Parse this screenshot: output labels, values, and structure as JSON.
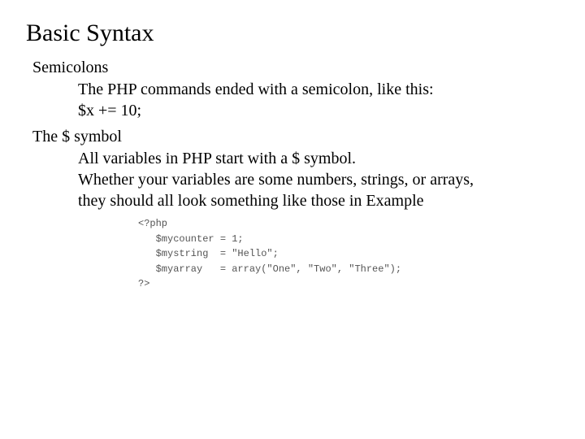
{
  "title": "Basic Syntax",
  "semicolons": {
    "heading": "Semicolons",
    "line1": "The PHP commands ended with a semicolon, like this:",
    "line2": "$x += 10;"
  },
  "dollar": {
    "heading": "The $ symbol",
    "line1": "All variables in PHP start with a $ symbol.",
    "line2": "Whether your variables are some numbers, strings, or arrays,",
    "line3": "they should all look something like those in Example"
  },
  "code": {
    "l1": "<?php",
    "l2": "   $mycounter = 1;",
    "l3": "   $mystring  = \"Hello\";",
    "l4": "   $myarray   = array(\"One\", \"Two\", \"Three\");",
    "l5": "?>"
  }
}
